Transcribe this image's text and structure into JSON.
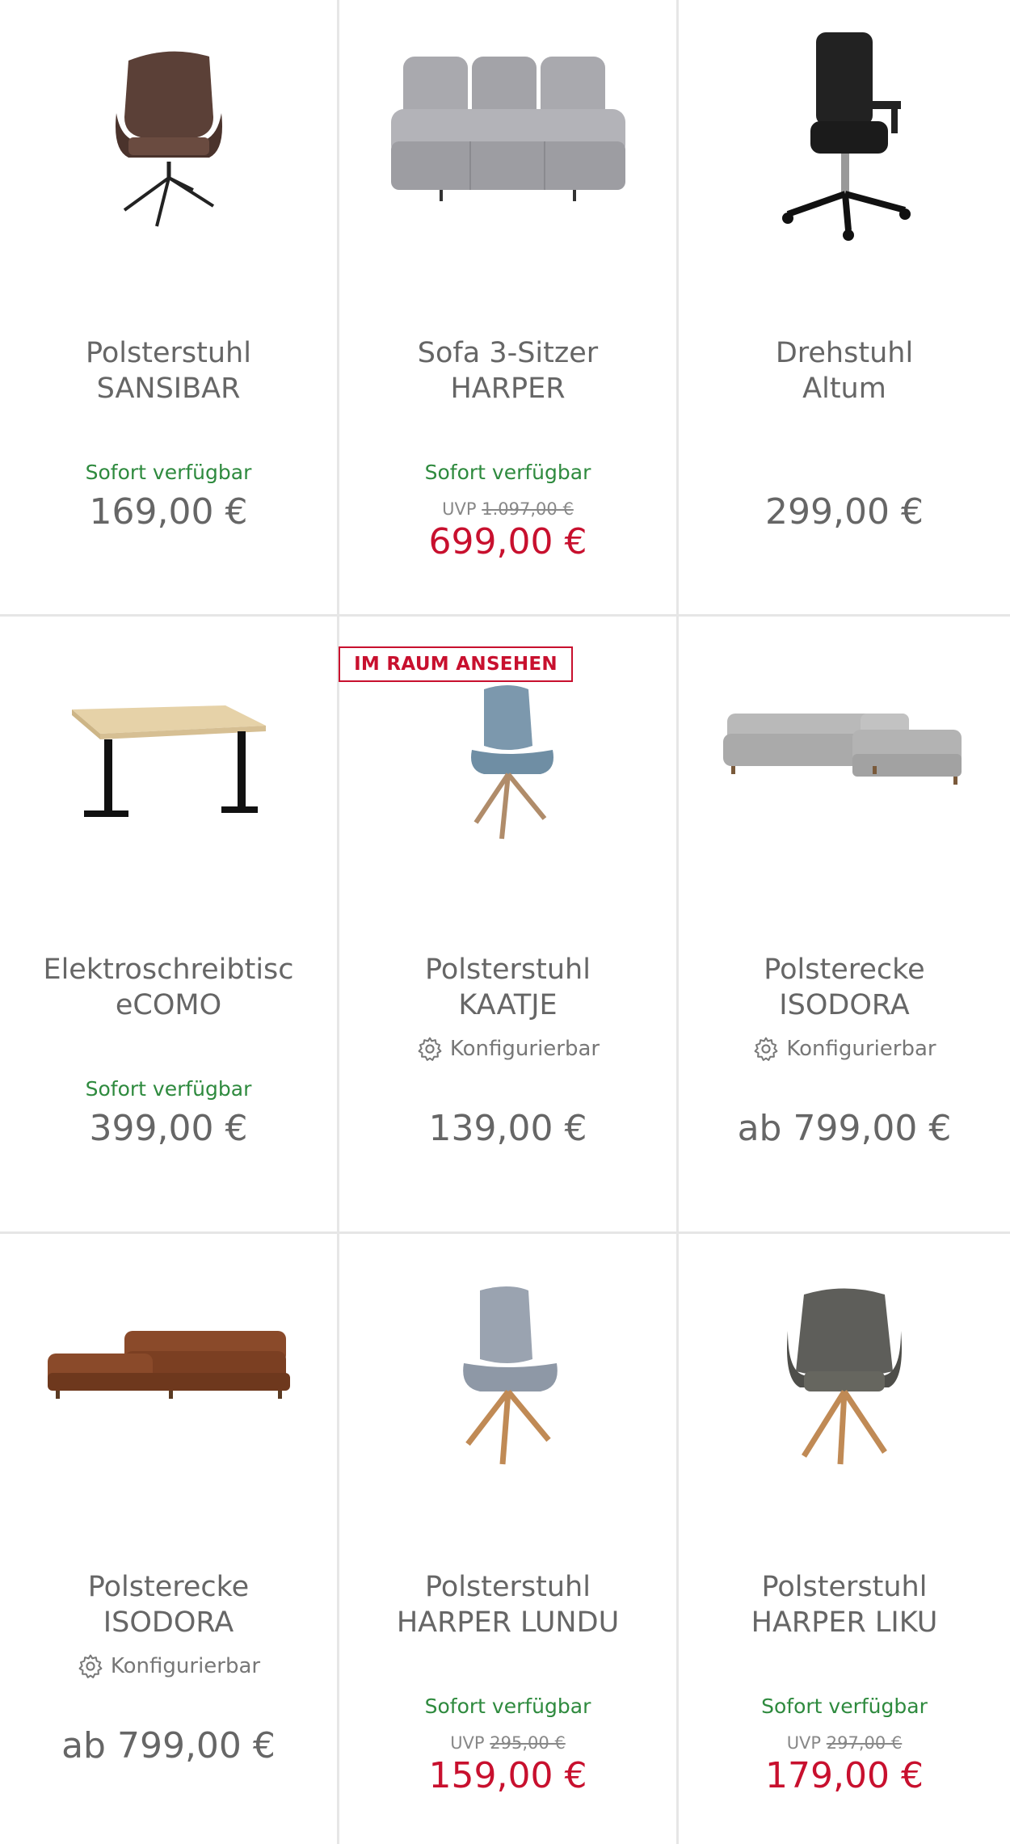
{
  "products": [
    {
      "title_line1": "Polsterstuhl",
      "title_line2": "SANSIBAR",
      "availability": "Sofort verfügbar",
      "price": "169,00 €",
      "image_icon": "armchair-brown-icon"
    },
    {
      "title_line1": "Sofa 3-Sitzer",
      "title_line2": "HARPER",
      "availability": "Sofort verfügbar",
      "uvp_label": "UVP",
      "uvp_price": "1.097,00 €",
      "price": "699,00 €",
      "image_icon": "sofa-grey-icon"
    },
    {
      "title_line1": "Drehstuhl",
      "title_line2": "Altum",
      "price": "299,00 €",
      "image_icon": "office-chair-icon"
    },
    {
      "title_line1": "Elektroschreibtisc",
      "title_line2": "eCOMO",
      "availability": "Sofort verfügbar",
      "price": "399,00 €",
      "image_icon": "desk-icon"
    },
    {
      "badge": "IM RAUM ANSEHEN",
      "title_line1": "Polsterstuhl",
      "title_line2": "KAATJE",
      "config_label": "Konfigurierbar",
      "price": "139,00 €",
      "image_icon": "chair-blue-icon"
    },
    {
      "title_line1": "Polsterecke",
      "title_line2": "ISODORA",
      "config_label": "Konfigurierbar",
      "price": "ab 799,00 €",
      "image_icon": "corner-sofa-grey-icon"
    },
    {
      "title_line1": "Polsterecke",
      "title_line2": "ISODORA",
      "config_label": "Konfigurierbar",
      "price": "ab 799,00 €",
      "image_icon": "corner-sofa-brown-icon"
    },
    {
      "title_line1": "Polsterstuhl",
      "title_line2": "HARPER LUNDU",
      "availability": "Sofort verfügbar",
      "uvp_label": "UVP",
      "uvp_price": "295,00 €",
      "price": "159,00 €",
      "image_icon": "chair-grey-icon"
    },
    {
      "title_line1": "Polsterstuhl",
      "title_line2": "HARPER LIKU",
      "availability": "Sofort verfügbar",
      "uvp_label": "UVP",
      "uvp_price": "297,00 €",
      "price": "179,00 €",
      "image_icon": "armchair-dark-icon"
    }
  ],
  "colors": {
    "available_green": "#2e8a3e",
    "sale_red": "#c8102e",
    "text_grey": "#666666",
    "divider": "#e6e6e6"
  }
}
